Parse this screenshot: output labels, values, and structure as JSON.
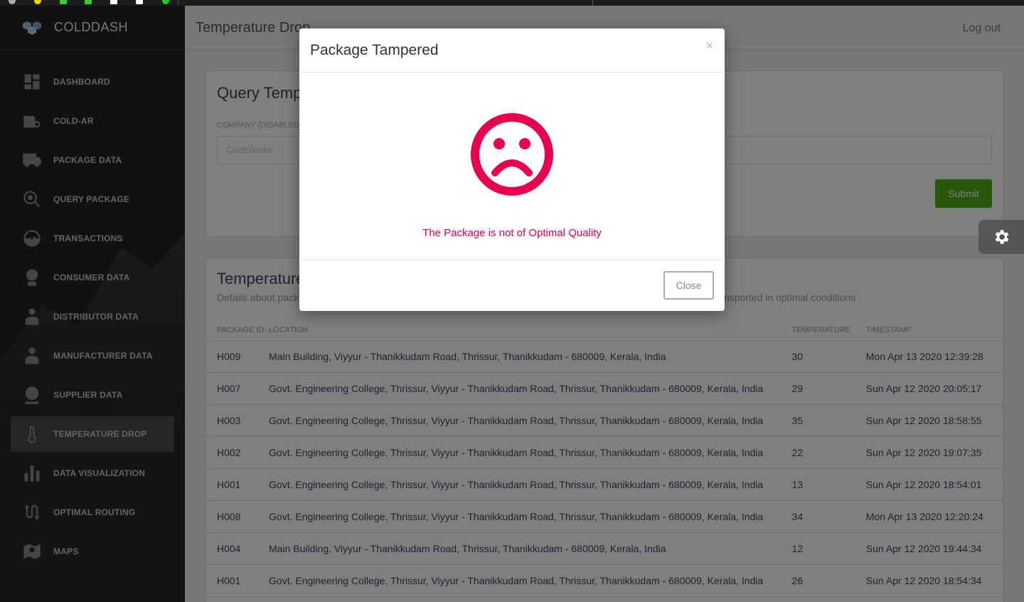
{
  "brand": {
    "name": "COLDDASH",
    "icon": "boxes-logo-icon"
  },
  "sidebar": {
    "items": [
      {
        "label": "DASHBOARD",
        "icon": "dashboard-icon",
        "active": false
      },
      {
        "label": "COLD-AR",
        "icon": "ar-camera-icon",
        "active": false
      },
      {
        "label": "PACKAGE DATA",
        "icon": "truck-icon",
        "active": false
      },
      {
        "label": "QUERY PACKAGE",
        "icon": "search-icon",
        "active": false
      },
      {
        "label": "TRANSACTIONS",
        "icon": "transactions-icon",
        "active": false
      },
      {
        "label": "CONSUMER DATA",
        "icon": "consumer-icon",
        "active": false
      },
      {
        "label": "DISTRIBUTOR DATA",
        "icon": "distributor-icon",
        "active": false
      },
      {
        "label": "MANUFACTURER DATA",
        "icon": "manufacturer-icon",
        "active": false
      },
      {
        "label": "SUPPLIER DATA",
        "icon": "supplier-icon",
        "active": false
      },
      {
        "label": "TEMPERATURE DROP",
        "icon": "thermometer-icon",
        "active": true
      },
      {
        "label": "DATA VISUALIZATION",
        "icon": "bar-chart-icon",
        "active": false
      },
      {
        "label": "OPTIMAL ROUTING",
        "icon": "routing-icon",
        "active": false
      },
      {
        "label": "MAPS",
        "icon": "map-icon",
        "active": false
      }
    ]
  },
  "header": {
    "title": "Temperature Drop",
    "logout_label": "Log out"
  },
  "query_card": {
    "title": "Query Temp",
    "company_label": "COMPANY (DISABLED",
    "company_value": "ColdBlocks",
    "submit_label": "Submit"
  },
  "table_card": {
    "title": "Temperature",
    "subtitle_left": "Details about pack",
    "subtitle_right": "nsported in optimal conditions",
    "columns": [
      "PACKAGE ID",
      "LOCATION",
      "TEMPERATURE",
      "TIMESTAMP"
    ],
    "rows": [
      [
        "H009",
        "Main Building, Viyyur - Thanikkudam Road, Thrissur, Thanikkudam - 680009, Kerala, India",
        "30",
        "Mon Apr 13 2020 12:39:28"
      ],
      [
        "H007",
        "Govt. Engineering College, Thrissur, Viyyur - Thanikkudam Road, Thrissur, Thanikkudam - 680009, Kerala, India",
        "29",
        "Sun Apr 12 2020 20:05:17"
      ],
      [
        "H003",
        "Govt. Engineering College, Thrissur, Viyyur - Thanikkudam Road, Thrissur, Thanikkudam - 680009, Kerala, India",
        "35",
        "Sun Apr 12 2020 18:58:55"
      ],
      [
        "H002",
        "Govt. Engineering College, Thrissur, Viyyur - Thanikkudam Road, Thrissur, Thanikkudam - 680009, Kerala, India",
        "22",
        "Sun Apr 12 2020 19:07:35"
      ],
      [
        "H001",
        "Govt. Engineering College, Thrissur, Viyyur - Thanikkudam Road, Thrissur, Thanikkudam - 680009, Kerala, India",
        "13",
        "Sun Apr 12 2020 18:54:01"
      ],
      [
        "H008",
        "Govt. Engineering College, Thrissur, Viyyur - Thanikkudam Road, Thrissur, Thanikkudam - 680009, Kerala, India",
        "34",
        "Mon Apr 13 2020 12:20:24"
      ],
      [
        "H004",
        "Main Building, Viyyur - Thanikkudam Road, Thrissur, Thanikkudam - 680009, Kerala, India",
        "12",
        "Sun Apr 12 2020 19:44:34"
      ],
      [
        "H001",
        "Govt. Engineering College, Thrissur, Viyyur - Thanikkudam Road, Thrissur, Thanikkudam - 680009, Kerala, India",
        "26",
        "Sun Apr 12 2020 18:54:34"
      ]
    ]
  },
  "modal": {
    "title": "Package Tampered",
    "close_x": "×",
    "message": "The Package is not of Optimal Quality",
    "close_label": "Close",
    "icon": "sad-face-icon"
  },
  "colors": {
    "accent_red": "#e8004c",
    "submit_green": "#4caf15",
    "sidebar_bg": "#232323"
  }
}
